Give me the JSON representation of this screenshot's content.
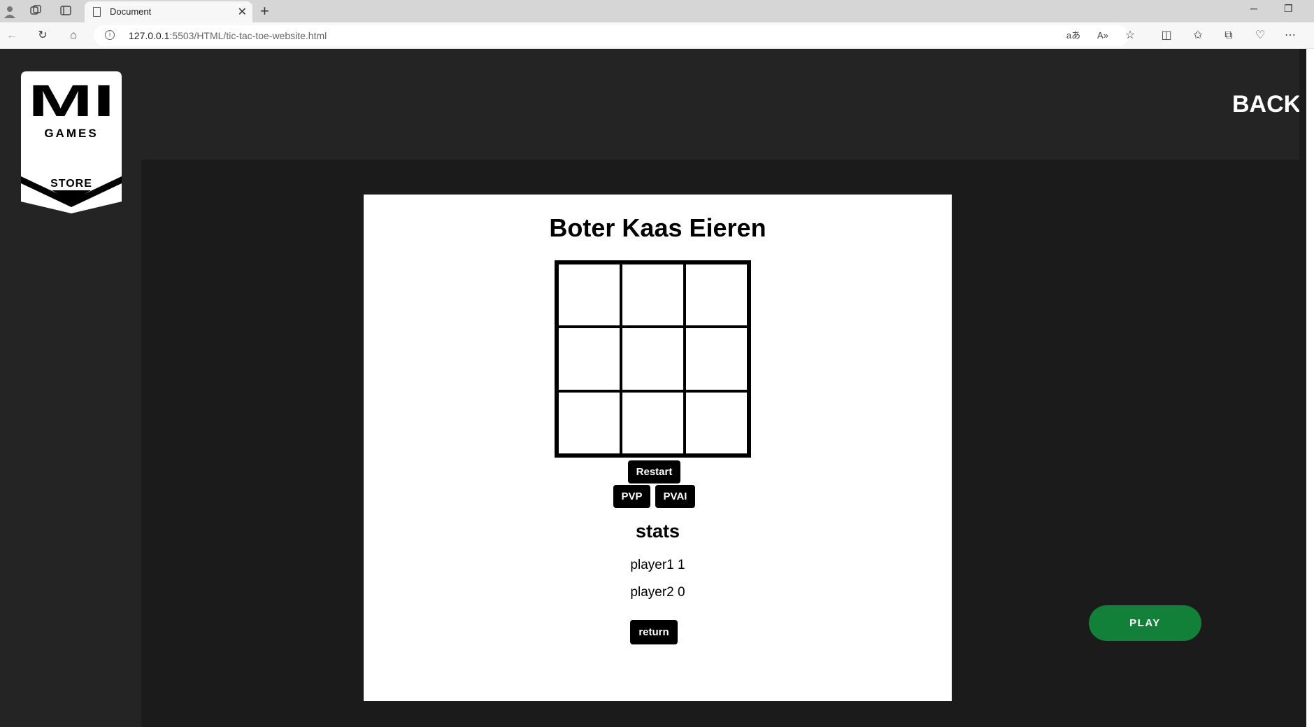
{
  "browser": {
    "tab_title": "Document",
    "url_host": "127.0.0.1",
    "url_rest": ":5503/HTML/tic-tac-toe-website.html"
  },
  "header": {
    "logo_top": "MI",
    "logo_middle": "GAMES",
    "logo_bottom": "STORE",
    "back_label": "BACK"
  },
  "game": {
    "title": "Boter Kaas Eieren",
    "board": [
      "",
      "",
      "",
      "",
      "",
      "",
      "",
      "",
      ""
    ],
    "restart_label": "Restart",
    "pvp_label": "PVP",
    "pvai_label": "PVAI",
    "stats_title": "stats",
    "player1_stat": "player1 1",
    "player2_stat": "player2 0",
    "return_label": "return"
  },
  "play_label": "PLAY",
  "colors": {
    "page_bg": "#1b1b1b",
    "header_bg": "#242424",
    "play_button": "#13803a"
  }
}
